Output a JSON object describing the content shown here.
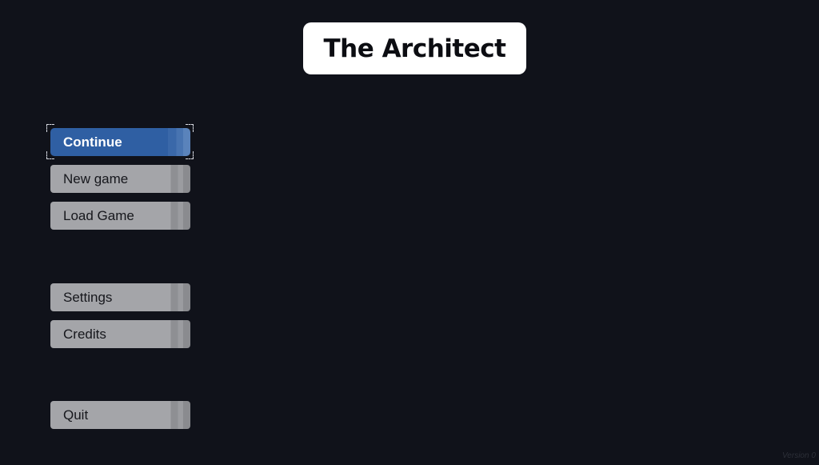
{
  "title": "The Architect",
  "menu": {
    "continue": "Continue",
    "new_game": "New game",
    "load_game": "Load Game",
    "settings": "Settings",
    "credits": "Credits",
    "quit": "Quit"
  },
  "version_text": "Version 0",
  "colors": {
    "background": "#10121a",
    "selected_button": "#2f5fa3",
    "button": "#a4a5a9",
    "title_box": "#ffffff"
  }
}
